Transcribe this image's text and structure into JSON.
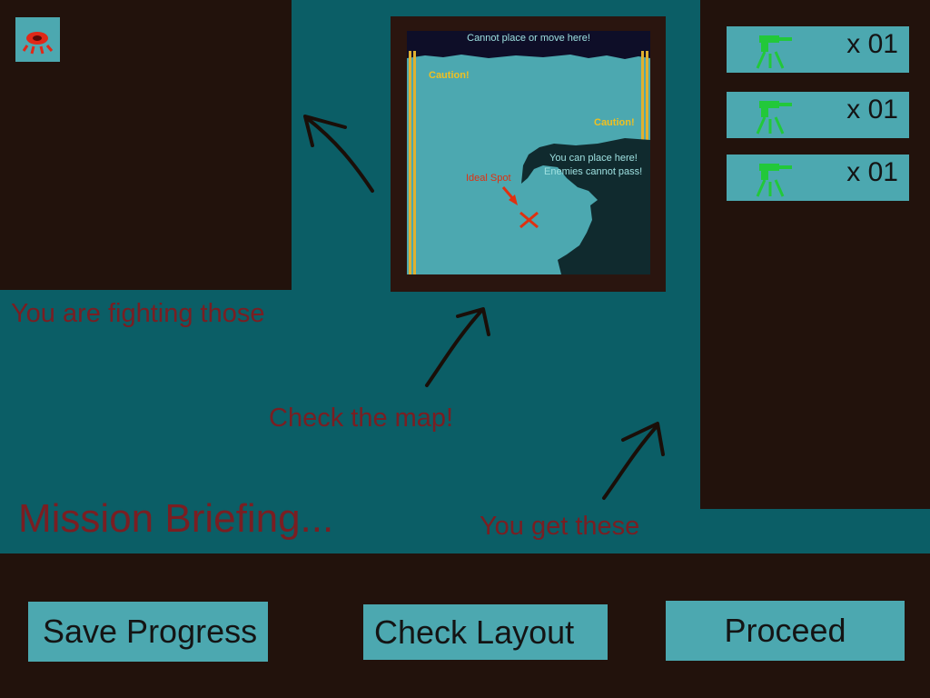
{
  "enemy_panel": {
    "icon": "red-enemy-bug-icon"
  },
  "captions": {
    "enemies": "You are fighting those",
    "map": "Check the map!",
    "units": "You get these",
    "title": "Mission Briefing..."
  },
  "map": {
    "header": "Cannot place or move here!",
    "caution_left": "Caution!",
    "caution_right": "Caution!",
    "place_line1": "You can place here!",
    "place_line2": "Enemies cannot pass!",
    "ideal_spot": "Ideal Spot"
  },
  "units": [
    {
      "icon": "green-turret-icon",
      "count": "x 01"
    },
    {
      "icon": "green-turret-icon",
      "count": "x 01"
    },
    {
      "icon": "green-turret-icon",
      "count": "x 01"
    }
  ],
  "buttons": {
    "save": "Save Progress",
    "layout": "Check Layout",
    "proceed": "Proceed"
  },
  "colors": {
    "background": "#0b5e66",
    "panel": "#22120c",
    "accent": "#4ca8b0",
    "caption": "#7a1e22",
    "caution": "#f0c020",
    "marker": "#e03010",
    "turret": "#22c83a"
  }
}
